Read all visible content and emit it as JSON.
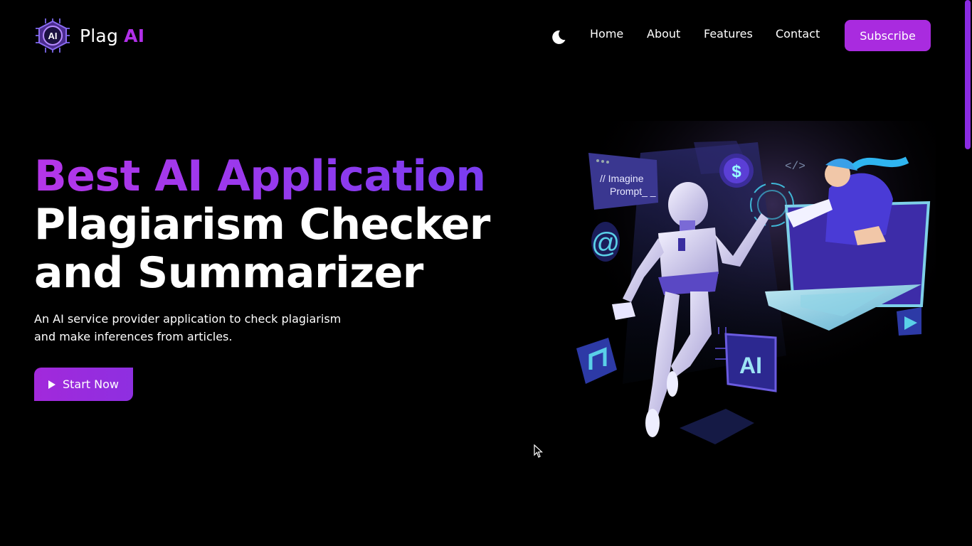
{
  "header": {
    "brand_name": "Plag",
    "brand_accent": "AI",
    "logo_badge": "AI",
    "nav": [
      "Home",
      "About",
      "Features",
      "Contact"
    ],
    "subscribe_label": "Subscribe",
    "theme_toggle_icon": "moon-icon"
  },
  "hero": {
    "title_line1": "Best AI Application",
    "title_line2": "Plagiarism Checker",
    "title_line3": "and Summarizer",
    "subtitle": "An AI service provider application to check plagiarism and make inferences from articles.",
    "cta_label": "Start Now",
    "cta_icon": "play-icon",
    "illustration": {
      "prompt_text_1": "// Imagine",
      "prompt_text_2": "Prompt_ _",
      "code_tag": "</>",
      "chip_label": "AI",
      "coin_symbol": "$",
      "at_symbol": "@"
    }
  },
  "colors": {
    "accent": "#a92bdf",
    "accent_gradient_end": "#7a3cf0",
    "background": "#000000"
  }
}
